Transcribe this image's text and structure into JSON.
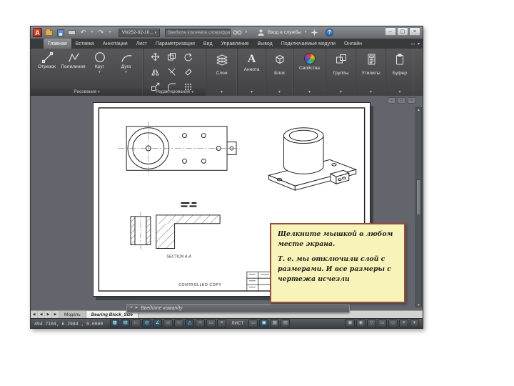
{
  "colors": {
    "canvas_bg": "#62666c",
    "note_bg": "#f8f3b8",
    "note_border": "#9c4a3a",
    "logo_red": "#c0392b",
    "ribbon_bg": "#4c4c4e"
  },
  "icons": {
    "logo_letter": "A",
    "chevron_down": "▾",
    "close": "×",
    "minimize": "–",
    "restore": "▢",
    "help": "?",
    "undo": "↶",
    "redo": "↷",
    "panel_button": "▭",
    "nav_first": "◀",
    "nav_prev": "◀",
    "nav_next": "▶",
    "nav_last": "▶",
    "scroll_up": "▲",
    "scroll_down": "▼",
    "annotation_letter": "A",
    "command_tools": "▸"
  },
  "titlebar": {
    "filename": "VN252-02-10...",
    "search_placeholder": "Введите ключевое слово/фразу",
    "signin_label": "Вход в службы"
  },
  "ribbon": {
    "tabs": [
      {
        "label": "Главная"
      },
      {
        "label": "Вставка"
      },
      {
        "label": "Аннотации"
      },
      {
        "label": "Лист"
      },
      {
        "label": "Параметризация"
      },
      {
        "label": "Вид"
      },
      {
        "label": "Управление"
      },
      {
        "label": "Вывод"
      },
      {
        "label": "Подключаемые модули"
      },
      {
        "label": "Онлайн"
      }
    ],
    "draw_panel_title": "Рисование",
    "edit_panel_title": "Редактирование",
    "draw_tools": [
      {
        "label": "Отрезок"
      },
      {
        "label": "Полилиния"
      },
      {
        "label": "Круг"
      },
      {
        "label": "Дуга"
      }
    ],
    "collapsed_panels": [
      {
        "label": "Слои"
      },
      {
        "label": "Аннота"
      },
      {
        "label": "Блок"
      },
      {
        "label": "Свойства"
      },
      {
        "label": "Группы"
      },
      {
        "label": "Утилиты"
      },
      {
        "label": "Буфер"
      }
    ]
  },
  "canvas": {
    "note": {
      "line1": "Щелкните мышкой в любом месте экрана.",
      "line2": "Т. е. мы отключили слой с размерами. И все размеры с чертежа исчезли"
    },
    "command_line": {
      "prompt": "Введите команду"
    },
    "sheet": {
      "section_label": "SECTION A-A",
      "stamp": "CONTROLLED COPY"
    }
  },
  "layout_tabs": {
    "model": "Модель",
    "layout": "Bearing Block_Size"
  },
  "statusbar": {
    "coordinates": "494.7104, 6.2984 , 0.0000",
    "space_label": "ЛИСТ",
    "toggles": [
      {
        "glyph": "▦"
      },
      {
        "glyph": "▤"
      },
      {
        "glyph": "∟"
      },
      {
        "glyph": "◎"
      },
      {
        "glyph": "∠"
      },
      {
        "glyph": "▱"
      },
      {
        "glyph": "◇"
      },
      {
        "glyph": "△"
      },
      {
        "glyph": "≈"
      },
      {
        "glyph": "▭"
      },
      {
        "glyph": "≡"
      }
    ],
    "mid_buttons": [
      {
        "glyph": "▭"
      },
      {
        "glyph": "▣"
      },
      {
        "glyph": "▦"
      },
      {
        "glyph": "▤"
      }
    ],
    "right_buttons": [
      {
        "glyph": "▣"
      },
      {
        "glyph": "◉"
      },
      {
        "glyph": "▽"
      },
      {
        "glyph": "▭"
      },
      {
        "glyph": "◇"
      },
      {
        "glyph": "≡"
      },
      {
        "glyph": "▾"
      }
    ]
  }
}
